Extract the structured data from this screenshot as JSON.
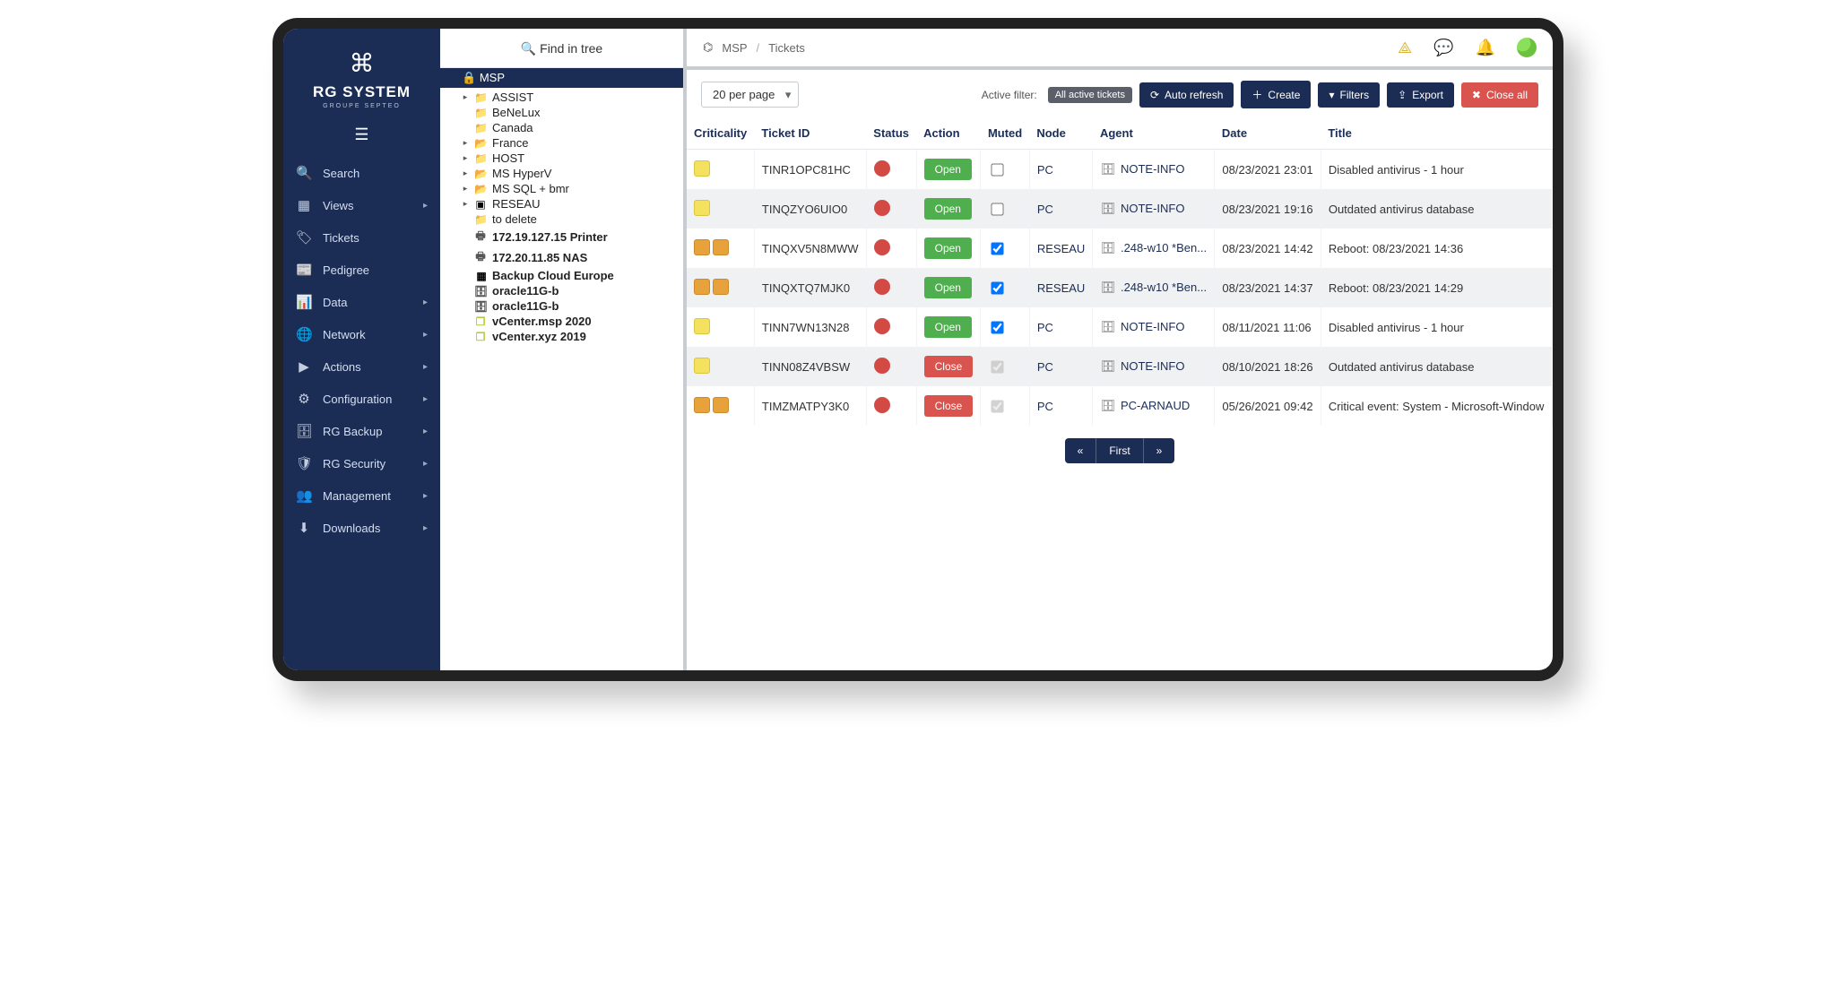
{
  "brand": {
    "name": "RG SYSTEM",
    "subline": "GROUPE SEPTEO"
  },
  "rail": [
    {
      "icon": "🔍",
      "label": "Search",
      "expandable": false
    },
    {
      "icon": "▦",
      "label": "Views",
      "expandable": true
    },
    {
      "icon": "🏷",
      "label": "Tickets",
      "expandable": false
    },
    {
      "icon": "📰",
      "label": "Pedigree",
      "expandable": false
    },
    {
      "icon": "📊",
      "label": "Data",
      "expandable": true
    },
    {
      "icon": "🌐",
      "label": "Network",
      "expandable": true
    },
    {
      "icon": "▶",
      "label": "Actions",
      "expandable": true
    },
    {
      "icon": "⚙",
      "label": "Configuration",
      "expandable": true
    },
    {
      "icon": "🗄",
      "label": "RG Backup",
      "expandable": true
    },
    {
      "icon": "🛡",
      "label": "RG Security",
      "expandable": true
    },
    {
      "icon": "👥",
      "label": "Management",
      "expandable": true
    },
    {
      "icon": "⬇",
      "label": "Downloads",
      "expandable": true
    }
  ],
  "tree": {
    "find_label": "Find in tree",
    "root": "MSP",
    "nodes": [
      {
        "icon": "folder",
        "label": "ASSIST",
        "twist": "▸",
        "bold": false
      },
      {
        "icon": "folder",
        "label": "BeNeLux",
        "twist": "",
        "bold": false
      },
      {
        "icon": "folder",
        "label": "Canada",
        "twist": "",
        "bold": false
      },
      {
        "icon": "folder-o",
        "label": "France",
        "twist": "▸",
        "bold": false
      },
      {
        "icon": "folder",
        "label": "HOST",
        "twist": "▸",
        "bold": false
      },
      {
        "icon": "folder-o",
        "label": "MS HyperV",
        "twist": "▸",
        "bold": false
      },
      {
        "icon": "folder-o",
        "label": "MS SQL + bmr",
        "twist": "▸",
        "bold": false
      },
      {
        "icon": "apple",
        "label": "RESEAU",
        "twist": "▸",
        "bold": false
      },
      {
        "icon": "folder",
        "label": "to delete",
        "twist": "",
        "bold": false
      },
      {
        "icon": "printer",
        "label": "172.19.127.15 Printer",
        "twist": "",
        "bold": true
      },
      {
        "icon": "printer",
        "label": "172.20.11.85 NAS",
        "twist": "",
        "bold": true
      },
      {
        "icon": "grid",
        "label": "Backup Cloud Europe",
        "twist": "",
        "bold": true
      },
      {
        "icon": "server",
        "label": "oracle11G-b",
        "twist": "",
        "bold": true
      },
      {
        "icon": "server",
        "label": "oracle11G-b",
        "twist": "",
        "bold": true
      },
      {
        "icon": "cube",
        "label": "vCenter.msp 2020",
        "twist": "",
        "bold": true
      },
      {
        "icon": "cube",
        "label": "vCenter.xyz 2019",
        "twist": "",
        "bold": true
      }
    ]
  },
  "breadcrumb": {
    "org": "MSP",
    "page": "Tickets"
  },
  "controls": {
    "per_page": "20 per page",
    "active_filter_label": "Active filter:",
    "active_filter_value": "All active tickets",
    "btn_autorefresh": "Auto refresh",
    "btn_create": "Create",
    "btn_filters": "Filters",
    "btn_export": "Export",
    "btn_closeall": "Close all"
  },
  "columns": {
    "criticality": "Criticality",
    "ticket_id": "Ticket ID",
    "status": "Status",
    "action": "Action",
    "muted": "Muted",
    "node": "Node",
    "agent": "Agent",
    "date": "Date",
    "title": "Title"
  },
  "rows": [
    {
      "criticality": [
        "yellow"
      ],
      "ticket_id": "TINR1OPC81HC",
      "action": "Open",
      "muted": false,
      "muted_disabled": false,
      "node": "PC",
      "agent": "NOTE-INFO",
      "date": "08/23/2021 23:01",
      "title": "Disabled antivirus - 1 hour"
    },
    {
      "criticality": [
        "yellow"
      ],
      "ticket_id": "TINQZYO6UIO0",
      "action": "Open",
      "muted": false,
      "muted_disabled": false,
      "node": "PC",
      "agent": "NOTE-INFO",
      "date": "08/23/2021 19:16",
      "title": "Outdated antivirus database"
    },
    {
      "criticality": [
        "orange",
        "orange"
      ],
      "ticket_id": "TINQXV5N8MWW",
      "action": "Open",
      "muted": true,
      "muted_disabled": false,
      "node": "RESEAU",
      "agent": ".248-w10 *Ben...",
      "date": "08/23/2021 14:42",
      "title": "Reboot: 08/23/2021 14:36"
    },
    {
      "criticality": [
        "orange",
        "orange"
      ],
      "ticket_id": "TINQXTQ7MJK0",
      "action": "Open",
      "muted": true,
      "muted_disabled": false,
      "node": "RESEAU",
      "agent": ".248-w10 *Ben...",
      "date": "08/23/2021 14:37",
      "title": "Reboot: 08/23/2021 14:29"
    },
    {
      "criticality": [
        "yellow"
      ],
      "ticket_id": "TINN7WN13N28",
      "action": "Open",
      "muted": true,
      "muted_disabled": false,
      "node": "PC",
      "agent": "NOTE-INFO",
      "date": "08/11/2021 11:06",
      "title": "Disabled antivirus - 1 hour"
    },
    {
      "criticality": [
        "yellow"
      ],
      "ticket_id": "TINN08Z4VBSW",
      "action": "Close",
      "muted": true,
      "muted_disabled": true,
      "node": "PC",
      "agent": "NOTE-INFO",
      "date": "08/10/2021 18:26",
      "title": "Outdated antivirus database"
    },
    {
      "criticality": [
        "orange",
        "orange"
      ],
      "ticket_id": "TIMZMATPY3K0",
      "action": "Close",
      "muted": true,
      "muted_disabled": true,
      "node": "PC",
      "agent": "PC-ARNAUD",
      "date": "05/26/2021 09:42",
      "title": "Critical event: System - Microsoft-Window"
    }
  ],
  "pagination": {
    "prev": "«",
    "first": "First",
    "next": "»"
  }
}
